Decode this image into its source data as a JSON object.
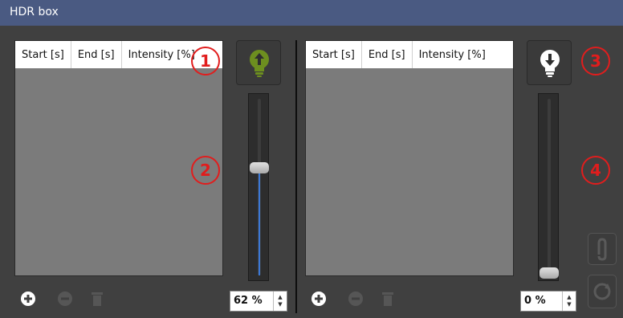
{
  "window": {
    "title": "HDR box"
  },
  "table_columns": [
    "Start [s]",
    "End [s]",
    "Intensity [%]"
  ],
  "left": {
    "columns": [
      "Start [s]",
      "End [s]",
      "Intensity [%]"
    ],
    "bulb_icon": "bulb-up-icon",
    "bulb_color": "#6d8f1f",
    "slider_percent": 62,
    "spin_value": "62 %"
  },
  "right": {
    "columns": [
      "Start [s]",
      "End [s]",
      "Intensity [%]"
    ],
    "bulb_icon": "bulb-down-icon",
    "bulb_color": "#ffffff",
    "slider_percent": 0,
    "spin_value": "0 %"
  },
  "callouts": [
    "1",
    "2",
    "3",
    "4"
  ],
  "toolbar_icons": [
    "add-icon",
    "remove-icon",
    "trash-icon"
  ],
  "side_icons": [
    "paperclip-icon",
    "refresh-icon"
  ],
  "accent_color": "#3b78d6",
  "callout_color": "#e11d1d"
}
